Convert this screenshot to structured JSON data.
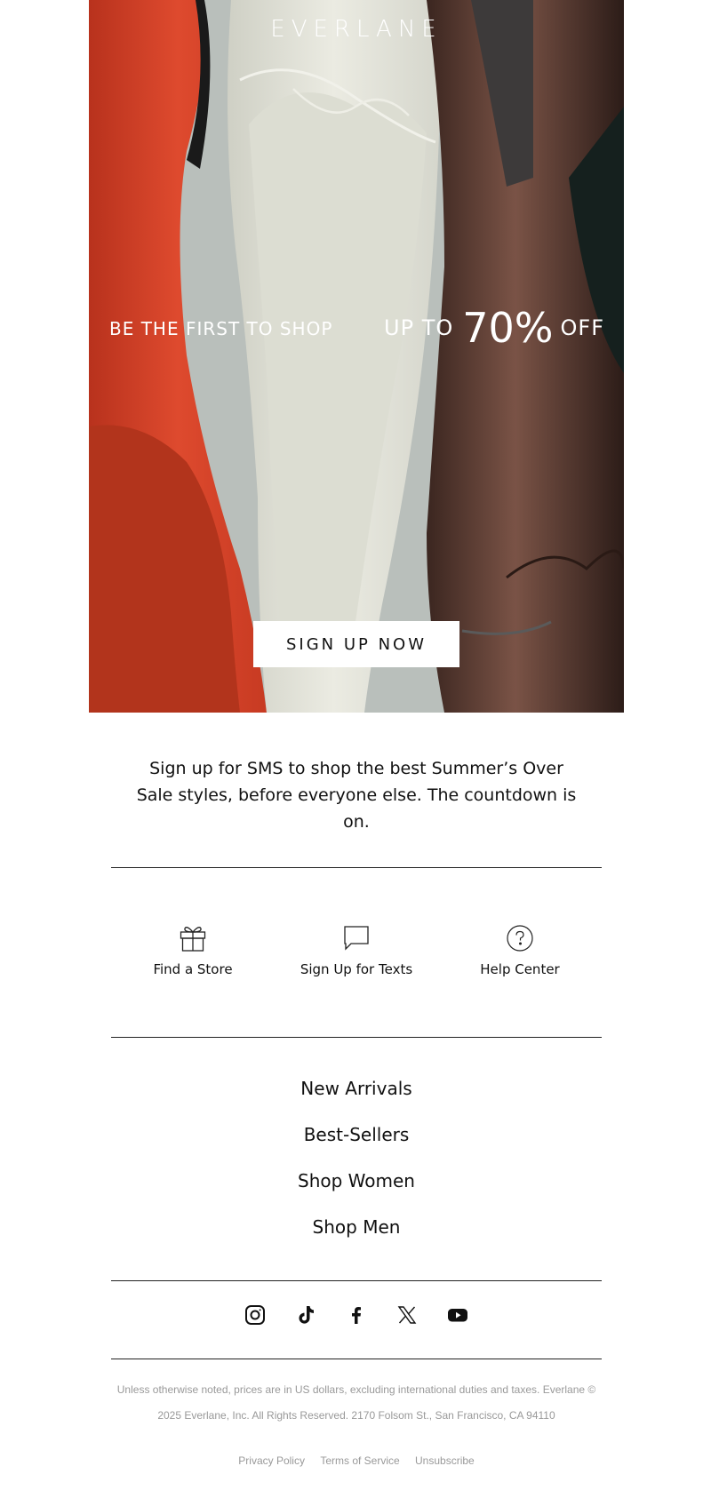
{
  "hero": {
    "brand": "EVERLANE",
    "tagline_left": "BE THE FIRST TO SHOP",
    "promo_prefix": "UP TO",
    "promo_value": "70%",
    "promo_suffix": "OFF",
    "cta_label": "SIGN UP NOW"
  },
  "intro": {
    "text": "Sign up for SMS to shop the best Summer’s Over Sale styles, before everyone else. The countdown is on."
  },
  "services": [
    {
      "label": "Find a Store",
      "icon": "gift-icon"
    },
    {
      "label": "Sign Up for Texts",
      "icon": "chat-bubble-icon"
    },
    {
      "label": "Help Center",
      "icon": "help-circle-icon"
    }
  ],
  "nav_links": [
    "New Arrivals",
    "Best-Sellers",
    "Shop Women",
    "Shop Men"
  ],
  "social": [
    "instagram-icon",
    "tiktok-icon",
    "facebook-icon",
    "x-icon",
    "youtube-icon"
  ],
  "legal": {
    "line1": "Unless otherwise noted, prices are in US dollars, excluding international duties and taxes. Everlane ©",
    "line2": "2025 Everlane, Inc. All Rights Reserved. 2170 Folsom St., San Francisco, CA 94110"
  },
  "footer_links": [
    "Privacy Policy",
    "Terms of Service",
    "Unsubscribe"
  ]
}
